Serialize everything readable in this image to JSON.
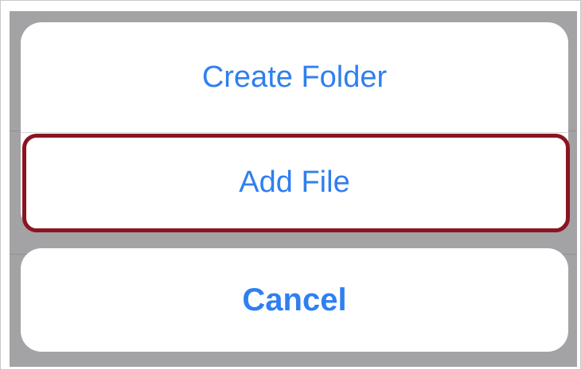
{
  "action_sheet": {
    "actions": [
      {
        "label": "Create Folder"
      },
      {
        "label": "Add File"
      }
    ],
    "cancel_label": "Cancel",
    "highlighted_action": "Add File"
  },
  "colors": {
    "action_text": "#2f7ff0",
    "highlight_border": "#8b1420",
    "backdrop": "#a3a3a6",
    "sheet_background": "#ffffff"
  }
}
